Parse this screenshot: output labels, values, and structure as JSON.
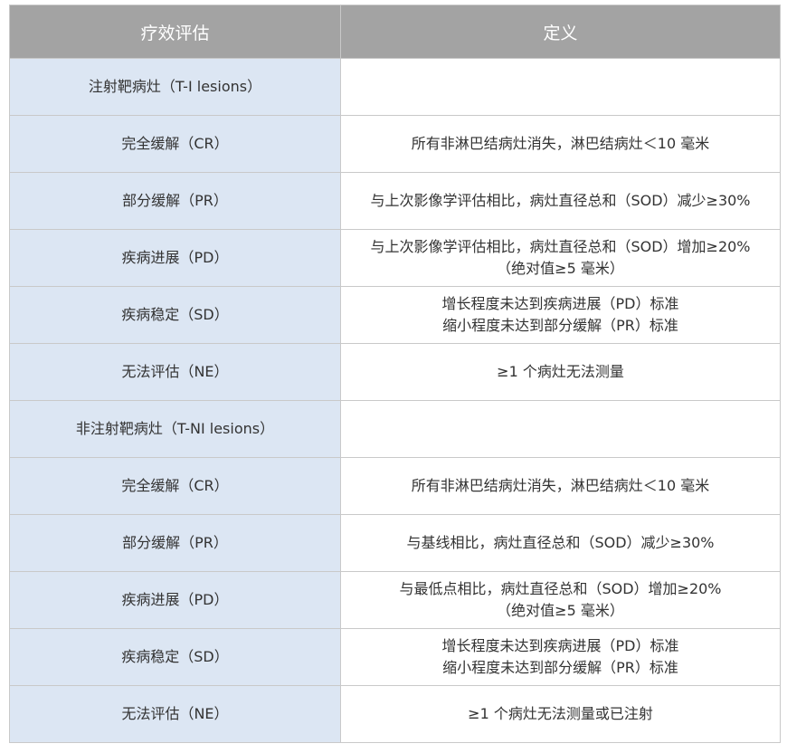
{
  "table": {
    "headers": {
      "col1": "疗效评估",
      "col2": "定义"
    },
    "rows": [
      {
        "assessment": "注射靶病灶（T-I lesions）",
        "def1": "",
        "def2": ""
      },
      {
        "assessment": "完全缓解（CR）",
        "def1": "所有非淋巴结病灶消失，淋巴结病灶＜10 毫米",
        "def2": ""
      },
      {
        "assessment": "部分缓解（PR）",
        "def1": "与上次影像学评估相比，病灶直径总和（SOD）减少≥30%",
        "def2": ""
      },
      {
        "assessment": "疾病进展（PD）",
        "def1": "与上次影像学评估相比，病灶直径总和（SOD）增加≥20%",
        "def2": "（绝对值≥5 毫米）"
      },
      {
        "assessment": "疾病稳定（SD）",
        "def1": "增长程度未达到疾病进展（PD）标准",
        "def2": "缩小程度未达到部分缓解（PR）标准"
      },
      {
        "assessment": "无法评估（NE）",
        "def1": "≥1 个病灶无法测量",
        "def2": ""
      },
      {
        "assessment": "非注射靶病灶（T-NI lesions）",
        "def1": "",
        "def2": ""
      },
      {
        "assessment": "完全缓解（CR）",
        "def1": "所有非淋巴结病灶消失，淋巴结病灶＜10 毫米",
        "def2": ""
      },
      {
        "assessment": "部分缓解（PR）",
        "def1": "与基线相比，病灶直径总和（SOD）减少≥30%",
        "def2": ""
      },
      {
        "assessment": "疾病进展（PD）",
        "def1": "与最低点相比，病灶直径总和（SOD）增加≥20%",
        "def2": "（绝对值≥5 毫米）"
      },
      {
        "assessment": "疾病稳定（SD）",
        "def1": "增长程度未达到疾病进展（PD）标准",
        "def2": "缩小程度未达到部分缓解（PR）标准"
      },
      {
        "assessment": "无法评估（NE）",
        "def1": "≥1 个病灶无法测量或已注射",
        "def2": ""
      }
    ]
  },
  "colors": {
    "header_bg": "#a3a3a3",
    "left_col_bg": "#dce6f3",
    "border": "#c9c9c9"
  }
}
